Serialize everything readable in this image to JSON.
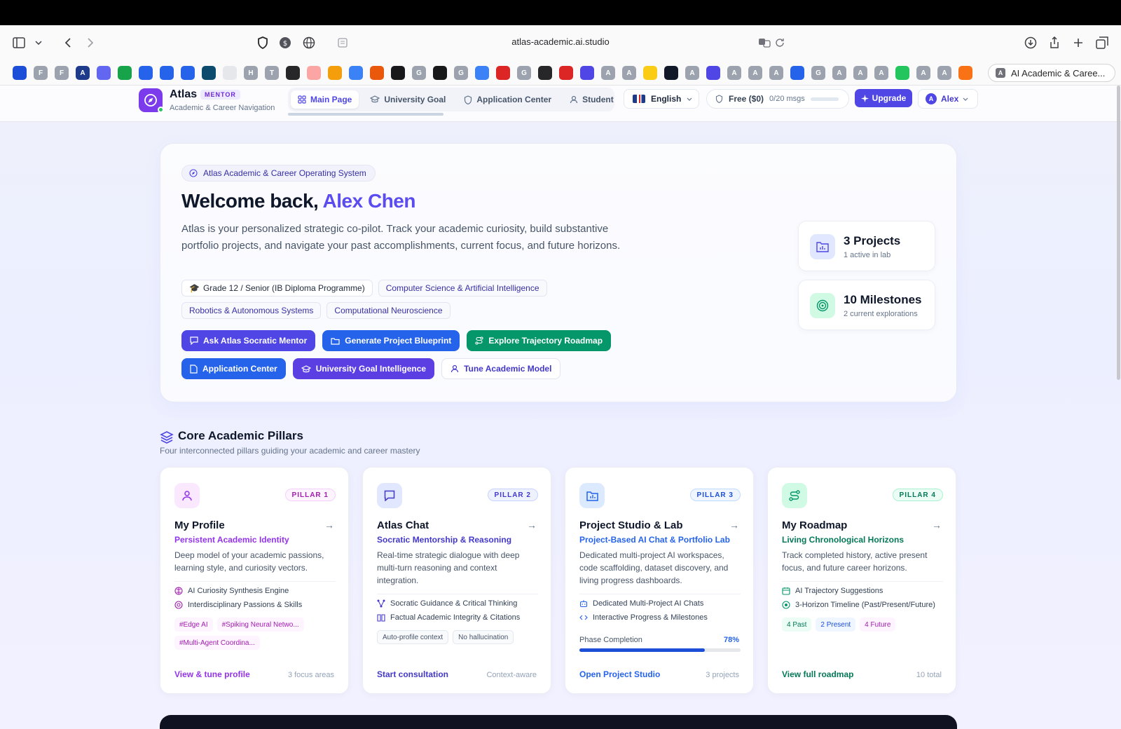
{
  "browser": {
    "url": "atlas-academic.ai.studio",
    "active_tab_title": "AI Academic & Caree...",
    "bookmarks": [
      {
        "label": "",
        "color": "#1d4ed8"
      },
      {
        "label": "F",
        "color": "#9ca3af"
      },
      {
        "label": "F",
        "color": "#9ca3af"
      },
      {
        "label": "A",
        "color": "#1e3a8a"
      },
      {
        "label": "",
        "color": "#6366f1"
      },
      {
        "label": "",
        "color": "#16a34a"
      },
      {
        "label": "",
        "color": "#2563eb"
      },
      {
        "label": "",
        "color": "#2563eb"
      },
      {
        "label": "",
        "color": "#2563eb"
      },
      {
        "label": "",
        "color": "#0c4a6e"
      },
      {
        "label": "",
        "color": "#e5e7eb"
      },
      {
        "label": "H",
        "color": "#9ca3af"
      },
      {
        "label": "T",
        "color": "#9ca3af"
      },
      {
        "label": "",
        "color": "#27272a"
      },
      {
        "label": "",
        "color": "#fca5a5"
      },
      {
        "label": "",
        "color": "#f59e0b"
      },
      {
        "label": "",
        "color": "#3b82f6"
      },
      {
        "label": "",
        "color": "#ea580c"
      },
      {
        "label": "",
        "color": "#18181b"
      },
      {
        "label": "G",
        "color": "#9ca3af"
      },
      {
        "label": "",
        "color": "#18181b"
      },
      {
        "label": "G",
        "color": "#9ca3af"
      },
      {
        "label": "",
        "color": "#3b82f6"
      },
      {
        "label": "",
        "color": "#dc2626"
      },
      {
        "label": "G",
        "color": "#9ca3af"
      },
      {
        "label": "",
        "color": "#27272a"
      },
      {
        "label": "",
        "color": "#dc2626"
      },
      {
        "label": "",
        "color": "#4f46e5"
      },
      {
        "label": "A",
        "color": "#9ca3af"
      },
      {
        "label": "A",
        "color": "#9ca3af"
      },
      {
        "label": "",
        "color": "#facc15"
      },
      {
        "label": "",
        "color": "#111827"
      },
      {
        "label": "A",
        "color": "#9ca3af"
      },
      {
        "label": "",
        "color": "#4f46e5"
      },
      {
        "label": "A",
        "color": "#9ca3af"
      },
      {
        "label": "A",
        "color": "#9ca3af"
      },
      {
        "label": "A",
        "color": "#9ca3af"
      },
      {
        "label": "",
        "color": "#2563eb"
      },
      {
        "label": "G",
        "color": "#9ca3af"
      },
      {
        "label": "A",
        "color": "#9ca3af"
      },
      {
        "label": "A",
        "color": "#9ca3af"
      },
      {
        "label": "A",
        "color": "#9ca3af"
      },
      {
        "label": "",
        "color": "#22c55e"
      },
      {
        "label": "A",
        "color": "#9ca3af"
      },
      {
        "label": "A",
        "color": "#9ca3af"
      },
      {
        "label": "",
        "color": "#f97316"
      }
    ]
  },
  "header": {
    "brand": "Atlas",
    "brand_badge": "MENTOR",
    "brand_sub": "Academic & Career Navigation",
    "tabs": [
      {
        "label": "Main Page",
        "icon": "grid-icon",
        "active": true
      },
      {
        "label": "University Goal",
        "icon": "graduation-cap-icon",
        "active": false
      },
      {
        "label": "Application Center",
        "icon": "shield-icon",
        "active": false
      },
      {
        "label": "Student",
        "icon": "person-icon",
        "active": false
      }
    ],
    "language": "English",
    "plan_name": "Free ($0)",
    "plan_msgs": "0/20 msgs",
    "plan_usage": 0,
    "upgrade_label": "Upgrade",
    "user_initial": "A",
    "user_name": "Alex"
  },
  "hero": {
    "pill": "Atlas Academic & Career Operating System",
    "title_prefix": "Welcome back, ",
    "title_name": "Alex Chen",
    "description": "Atlas is your personalized strategic co-pilot. Track your academic curiosity, build substantive portfolio projects, and navigate your past accomplishments, current focus, and future horizons.",
    "tags_row1": [
      "Grade 12 / Senior (IB Diploma Programme)",
      "Computer Science & Artificial Intelligence"
    ],
    "tags_row2": [
      "Robotics & Autonomous Systems",
      "Computational Neuroscience"
    ],
    "buttons_row1": [
      "Ask Atlas Socratic Mentor",
      "Generate Project Blueprint",
      "Explore Trajectory Roadmap"
    ],
    "buttons_row2": [
      "Application Center",
      "University Goal Intelligence",
      "Tune Academic Model"
    ],
    "stats": [
      {
        "title": "3 Projects",
        "sub": "1 active in lab"
      },
      {
        "title": "10 Milestones",
        "sub": "2 current explorations"
      }
    ]
  },
  "pillars": {
    "title": "Core Academic Pillars",
    "subtitle": "Four interconnected pillars guiding your academic and career mastery",
    "cards": [
      {
        "badge": "PILLAR 1",
        "title": "My Profile",
        "subtitle": "Persistent Academic Identity",
        "description": "Deep model of your academic passions, learning style, and curiosity vectors.",
        "features": [
          "AI Curiosity Synthesis Engine",
          "Interdisciplinary Passions & Skills"
        ],
        "chips": [
          "#Edge AI",
          "#Spiking Neural Netwo...",
          "#Multi-Agent Coordina..."
        ],
        "footer": "View & tune profile",
        "meta": "3 focus areas",
        "accent": "#9333ea"
      },
      {
        "badge": "PILLAR 2",
        "title": "Atlas Chat",
        "subtitle": "Socratic Mentorship & Reasoning",
        "description": "Real-time strategic dialogue with deep multi-turn reasoning and context integration.",
        "features": [
          "Socratic Guidance & Critical Thinking",
          "Factual Academic Integrity & Citations"
        ],
        "chips": [
          "Auto-profile context",
          "No hallucination"
        ],
        "footer": "Start consultation",
        "meta": "Context-aware",
        "accent": "#4338ca"
      },
      {
        "badge": "PILLAR 3",
        "title": "Project Studio & Lab",
        "subtitle": "Project-Based AI Chat & Portfolio Lab",
        "description": "Dedicated multi-project AI workspaces, code scaffolding, dataset discovery, and living progress dashboards.",
        "features": [
          "Dedicated Multi-Project AI Chats",
          "Interactive Progress & Milestones"
        ],
        "progress_label": "Phase Completion",
        "progress_value": "78%",
        "progress": 0.78,
        "footer": "Open Project Studio",
        "meta": "3 projects",
        "accent": "#2563eb"
      },
      {
        "badge": "PILLAR 4",
        "title": "My Roadmap",
        "subtitle": "Living Chronological Horizons",
        "description": "Track completed history, active present focus, and future career horizons.",
        "features": [
          "AI Trajectory Suggestions",
          "3-Horizon Timeline (Past/Present/Future)"
        ],
        "chips": [
          "4 Past",
          "2 Present",
          "4 Future"
        ],
        "footer": "View full roadmap",
        "meta": "10 total",
        "accent": "#059669"
      }
    ]
  }
}
